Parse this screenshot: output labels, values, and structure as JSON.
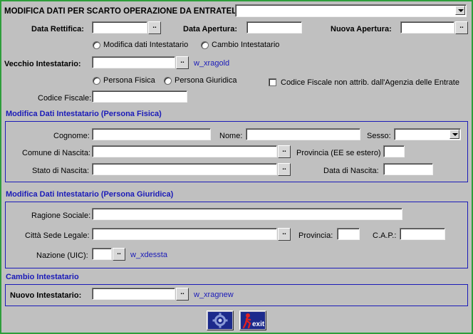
{
  "header": {
    "question": "MODIFICA DATI PER SCARTO OPERAZIONE DA ENTRATEL ?",
    "select_value": ""
  },
  "dates": {
    "rettifica_label": "Data Rettifica:",
    "rettifica_value": "",
    "apertura_label": "Data Apertura:",
    "apertura_value": "",
    "nuova_label": "Nuova Apertura:",
    "nuova_value": ""
  },
  "mode": {
    "option1": "Modifica dati Intestatario",
    "option2": "Cambio Intestatario"
  },
  "vecchio": {
    "label": "Vecchio Intestatario:",
    "value": "",
    "ref": "w_xragold"
  },
  "persona": {
    "fisica": "Persona Fisica",
    "giuridica": "Persona Giuridica",
    "cf_check": "Codice Fiscale non attrib. dall'Agenzia delle Entrate"
  },
  "codice_fiscale": {
    "label": "Codice Fiscale:",
    "value": ""
  },
  "fisica": {
    "title": "Modifica Dati Intestatario (Persona Fisica)",
    "cognome_label": "Cognome:",
    "nome_label": "Nome:",
    "sesso_label": "Sesso:",
    "comune_label": "Comune di Nascita:",
    "provincia_label": "Provincia (EE se estero)",
    "stato_label": "Stato di Nascita:",
    "data_label": "Data di Nascita:"
  },
  "giuridica": {
    "title": "Modifica Dati Intestatario (Persona Giuridica)",
    "ragione_label": "Ragione Sociale:",
    "citta_label": "Città Sede Legale:",
    "provincia_label": "Provincia:",
    "cap_label": "C.A.P.:",
    "nazione_label": "Nazione (UIC):",
    "nazione_ref": "w_xdessta"
  },
  "cambio": {
    "title": "Cambio Intestatario",
    "nuovo_label": "Nuovo Intestatario:",
    "nuovo_ref": "w_xragnew"
  },
  "buttons": {
    "lookup": "..",
    "exit_label": "exit"
  },
  "colors": {
    "background": "#c0c0c0",
    "section_blue": "#1a1ab8",
    "frame_green": "#2e9e3a",
    "exit_red": "#c01010"
  }
}
